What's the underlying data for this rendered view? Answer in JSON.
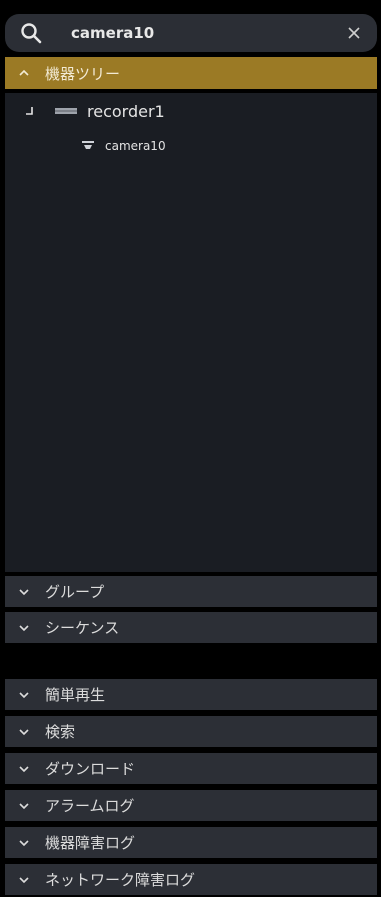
{
  "search": {
    "value": "camera10",
    "icon": "search-icon",
    "clear_icon": "close-icon"
  },
  "sections": {
    "device_tree": {
      "label": "機器ツリー",
      "expanded": true
    },
    "group": {
      "label": "グループ",
      "expanded": false
    },
    "sequence": {
      "label": "シーケンス",
      "expanded": false
    },
    "simple_playback": {
      "label": "簡単再生",
      "expanded": false
    },
    "search": {
      "label": "検索",
      "expanded": false
    },
    "download": {
      "label": "ダウンロード",
      "expanded": false
    },
    "alarm_log": {
      "label": "アラームログ",
      "expanded": false
    },
    "device_fault_log": {
      "label": "機器障害ログ",
      "expanded": false
    },
    "network_fault_log": {
      "label": "ネットワーク障害ログ",
      "expanded": false
    }
  },
  "tree": {
    "recorder": {
      "label": "recorder1",
      "icon": "recorder-icon"
    },
    "camera": {
      "label": "camera10",
      "icon": "camera-icon"
    }
  },
  "colors": {
    "active_header": "#9b7a25",
    "header_bg": "#2c2f36",
    "tree_bg": "#1a1d23",
    "panel_bg": "#000000"
  }
}
